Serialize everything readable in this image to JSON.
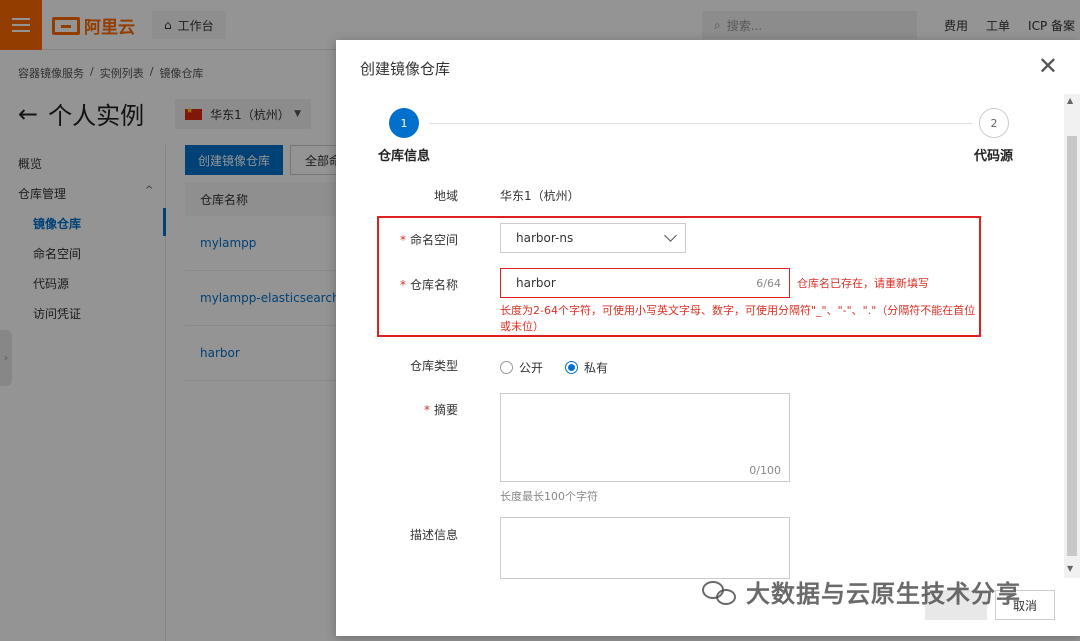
{
  "topbar": {
    "logo_text": "阿里云",
    "workbench": "工作台",
    "search_placeholder": "搜索...",
    "links": [
      "费用",
      "工单",
      "ICP 备案"
    ]
  },
  "breadcrumb": [
    "容器镜像服务",
    "/",
    "实例列表",
    "/",
    "镜像仓库"
  ],
  "page": {
    "title": "个人实例",
    "region": "华东1（杭州）"
  },
  "sidenav": {
    "items": [
      "概览",
      "仓库管理",
      "镜像仓库",
      "命名空间",
      "代码源",
      "访问凭证"
    ]
  },
  "list": {
    "create_button": "创建镜像仓库",
    "filter_button": "全部命",
    "column_header": "仓库名称",
    "rows": [
      "mylampp",
      "mylampp-elasticsearch",
      "harbor"
    ]
  },
  "modal": {
    "title": "创建镜像仓库",
    "steps": [
      {
        "number": "1",
        "label": "仓库信息"
      },
      {
        "number": "2",
        "label": "代码源"
      }
    ],
    "form": {
      "region_label": "地域",
      "region_value": "华东1（杭州）",
      "namespace_label": "命名空间",
      "namespace_value": "harbor-ns",
      "repo_name_label": "仓库名称",
      "repo_name_value": "harbor",
      "repo_name_counter": "6/64",
      "repo_name_error": "仓库名已存在，请重新填写",
      "repo_name_help": "长度为2-64个字符，可使用小写英文字母、数字，可使用分隔符\"_\"、\"-\"、\".\"（分隔符不能在首位或末位）",
      "repo_type_label": "仓库类型",
      "repo_type_options": [
        "公开",
        "私有"
      ],
      "repo_type_selected": "私有",
      "summary_label": "摘要",
      "summary_counter": "0/100",
      "summary_hint": "长度最长100个字符",
      "description_label": "描述信息"
    },
    "cancel_button": "取消"
  },
  "watermark": "大数据与云原生技术分享",
  "colors": {
    "brand": "#ff6a00",
    "primary": "#0070cc",
    "error": "#e02020"
  }
}
